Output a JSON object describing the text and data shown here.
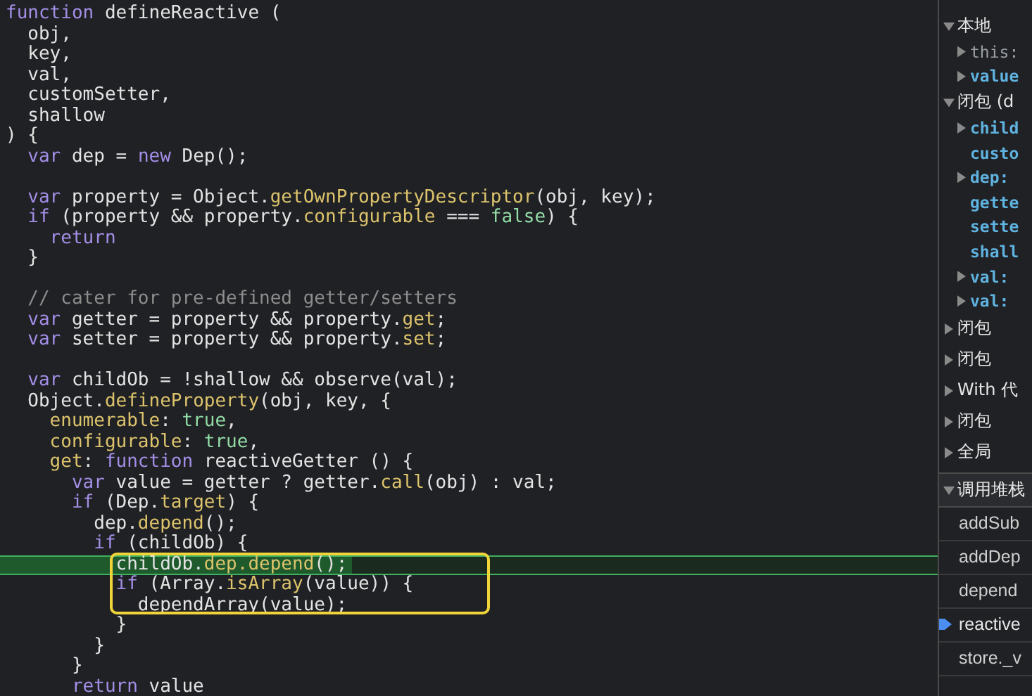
{
  "code": {
    "lines": [
      {
        "kind": "line",
        "segments": [
          {
            "text": "function",
            "kind": "kw"
          },
          {
            "text": " defineReactive (",
            "kind": "plain"
          }
        ],
        "current": false
      },
      {
        "kind": "line",
        "segments": [
          {
            "text": "  obj,",
            "kind": "plain"
          }
        ],
        "current": false
      },
      {
        "kind": "line",
        "segments": [
          {
            "text": "  key,",
            "kind": "plain"
          }
        ],
        "current": false
      },
      {
        "kind": "line",
        "segments": [
          {
            "text": "  val,",
            "kind": "plain"
          }
        ],
        "current": false
      },
      {
        "kind": "line",
        "segments": [
          {
            "text": "  customSetter,",
            "kind": "plain"
          }
        ],
        "current": false
      },
      {
        "kind": "line",
        "segments": [
          {
            "text": "  shallow",
            "kind": "plain"
          }
        ],
        "current": false
      },
      {
        "kind": "line",
        "segments": [
          {
            "text": ") {",
            "kind": "plain"
          }
        ],
        "current": false
      },
      {
        "kind": "line",
        "segments": [
          {
            "text": "  var",
            "kind": "kw"
          },
          {
            "text": " dep = ",
            "kind": "plain"
          },
          {
            "text": "new",
            "kind": "kw"
          },
          {
            "text": " Dep();",
            "kind": "plain"
          }
        ],
        "current": false
      },
      {
        "kind": "blank"
      },
      {
        "kind": "line",
        "segments": [
          {
            "text": "  var",
            "kind": "kw"
          },
          {
            "text": " property = Object.",
            "kind": "plain"
          },
          {
            "text": "getOwnPropertyDescriptor",
            "kind": "fn"
          },
          {
            "text": "(obj, key);",
            "kind": "plain"
          }
        ],
        "current": false
      },
      {
        "kind": "line",
        "segments": [
          {
            "text": "  if",
            "kind": "kw"
          },
          {
            "text": " (property && property.",
            "kind": "plain"
          },
          {
            "text": "configurable",
            "kind": "fn"
          },
          {
            "text": " === ",
            "kind": "plain"
          },
          {
            "text": "false",
            "kind": "lit"
          },
          {
            "text": ") {",
            "kind": "plain"
          }
        ],
        "current": false
      },
      {
        "kind": "line",
        "segments": [
          {
            "text": "    return",
            "kind": "kw"
          }
        ],
        "current": false
      },
      {
        "kind": "line",
        "segments": [
          {
            "text": "  }",
            "kind": "plain"
          }
        ],
        "current": false
      },
      {
        "kind": "blank"
      },
      {
        "kind": "line",
        "segments": [
          {
            "text": "  // cater for pre-defined getter/setters",
            "kind": "comment"
          }
        ],
        "current": false
      },
      {
        "kind": "line",
        "segments": [
          {
            "text": "  var",
            "kind": "kw"
          },
          {
            "text": " getter = property && property.",
            "kind": "plain"
          },
          {
            "text": "get",
            "kind": "fn"
          },
          {
            "text": ";",
            "kind": "plain"
          }
        ],
        "current": false
      },
      {
        "kind": "line",
        "segments": [
          {
            "text": "  var",
            "kind": "kw"
          },
          {
            "text": " setter = property && property.",
            "kind": "plain"
          },
          {
            "text": "set",
            "kind": "fn"
          },
          {
            "text": ";",
            "kind": "plain"
          }
        ],
        "current": false
      },
      {
        "kind": "blank"
      },
      {
        "kind": "line",
        "segments": [
          {
            "text": "  var",
            "kind": "kw"
          },
          {
            "text": " childOb = !shallow && observe(val);",
            "kind": "plain"
          }
        ],
        "current": false
      },
      {
        "kind": "line",
        "segments": [
          {
            "text": "  Object.",
            "kind": "plain"
          },
          {
            "text": "defineProperty",
            "kind": "fn"
          },
          {
            "text": "(obj, key, {",
            "kind": "plain"
          }
        ],
        "current": false
      },
      {
        "kind": "line",
        "segments": [
          {
            "text": "    enumerable",
            "kind": "fn"
          },
          {
            "text": ": ",
            "kind": "plain"
          },
          {
            "text": "true",
            "kind": "lit"
          },
          {
            "text": ",",
            "kind": "plain"
          }
        ],
        "current": false
      },
      {
        "kind": "line",
        "segments": [
          {
            "text": "    configurable",
            "kind": "fn"
          },
          {
            "text": ": ",
            "kind": "plain"
          },
          {
            "text": "true",
            "kind": "lit"
          },
          {
            "text": ",",
            "kind": "plain"
          }
        ],
        "current": false
      },
      {
        "kind": "line",
        "segments": [
          {
            "text": "    get",
            "kind": "fn"
          },
          {
            "text": ": ",
            "kind": "plain"
          },
          {
            "text": "function",
            "kind": "kw"
          },
          {
            "text": " reactiveGetter () {",
            "kind": "plain"
          }
        ],
        "current": false
      },
      {
        "kind": "line",
        "segments": [
          {
            "text": "      var",
            "kind": "kw"
          },
          {
            "text": " value = getter ? getter.",
            "kind": "plain"
          },
          {
            "text": "call",
            "kind": "fn"
          },
          {
            "text": "(obj) : val;",
            "kind": "plain"
          }
        ],
        "current": false
      },
      {
        "kind": "line",
        "segments": [
          {
            "text": "      if",
            "kind": "kw"
          },
          {
            "text": " (Dep.",
            "kind": "plain"
          },
          {
            "text": "target",
            "kind": "fn"
          },
          {
            "text": ") {",
            "kind": "plain"
          }
        ],
        "current": false
      },
      {
        "kind": "line",
        "segments": [
          {
            "text": "        dep.",
            "kind": "plain"
          },
          {
            "text": "depend",
            "kind": "fn"
          },
          {
            "text": "();",
            "kind": "plain"
          }
        ],
        "current": false
      },
      {
        "kind": "line",
        "segments": [
          {
            "text": "        if",
            "kind": "kw"
          },
          {
            "text": " (childOb) {",
            "kind": "plain"
          }
        ],
        "current": false
      },
      {
        "kind": "box",
        "lines": [
          {
            "segments": [
              {
                "text": "          childOb.",
                "kind": "plain"
              },
              {
                "text": "dep.depend",
                "kind": "fn"
              },
              {
                "text": "();",
                "kind": "plain"
              }
            ],
            "current": true
          },
          {
            "segments": [
              {
                "text": "          if",
                "kind": "kw"
              },
              {
                "text": " (Array.",
                "kind": "plain"
              },
              {
                "text": "isArray",
                "kind": "fn"
              },
              {
                "text": "(value)) {",
                "kind": "plain"
              }
            ],
            "current": false
          },
          {
            "segments": [
              {
                "text": "            dependArray(value);",
                "kind": "plain"
              }
            ],
            "current": false
          }
        ]
      },
      {
        "kind": "line",
        "segments": [
          {
            "text": "          }",
            "kind": "plain"
          }
        ],
        "current": false
      },
      {
        "kind": "line",
        "segments": [
          {
            "text": "        }",
            "kind": "plain"
          }
        ],
        "current": false
      },
      {
        "kind": "line",
        "segments": [
          {
            "text": "      }",
            "kind": "plain"
          }
        ],
        "current": false
      },
      {
        "kind": "line",
        "segments": [
          {
            "text": "      return",
            "kind": "kw"
          },
          {
            "text": " value",
            "kind": "plain"
          }
        ],
        "current": false
      }
    ]
  },
  "scope": {
    "sections": [
      {
        "label": "本地",
        "expanded": true,
        "children": [
          {
            "name": "this:",
            "kind": "this",
            "expandable": true
          },
          {
            "name": "value",
            "kind": "var",
            "expandable": true
          }
        ]
      },
      {
        "label": "闭包 (d",
        "expanded": true,
        "children": [
          {
            "name": "child",
            "kind": "var",
            "expandable": true
          },
          {
            "name": "custo",
            "kind": "var",
            "expandable": false
          },
          {
            "name": "dep:",
            "kind": "var",
            "expandable": true
          },
          {
            "name": "gette",
            "kind": "var",
            "expandable": false
          },
          {
            "name": "sette",
            "kind": "var",
            "expandable": false
          },
          {
            "name": "shall",
            "kind": "var",
            "expandable": false
          },
          {
            "name": "val:",
            "kind": "var",
            "expandable": true
          },
          {
            "name": "val:",
            "kind": "var",
            "expandable": true
          }
        ]
      },
      {
        "label": "闭包",
        "expanded": false
      },
      {
        "label": "闭包",
        "expanded": false
      },
      {
        "label": "With 代",
        "expanded": false
      },
      {
        "label": "闭包",
        "expanded": false
      },
      {
        "label": "全局",
        "expanded": false
      }
    ]
  },
  "call_stack": {
    "label": "调用堆栈",
    "expanded": true,
    "frames": [
      {
        "name": "addSub",
        "selected": false
      },
      {
        "name": "addDep",
        "selected": false
      },
      {
        "name": "depend",
        "selected": false
      },
      {
        "name": "reactive",
        "selected": true
      },
      {
        "name": "store._v",
        "selected": false
      }
    ]
  }
}
